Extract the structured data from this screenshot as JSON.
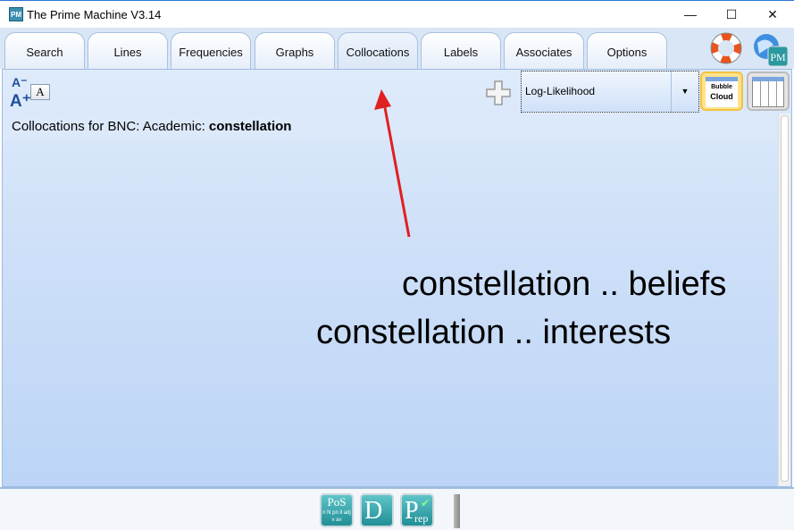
{
  "window": {
    "title": "The Prime Machine V3.14",
    "icon": "PM",
    "minimize": "—",
    "maximize": "☐",
    "close": "✕"
  },
  "tabs": [
    {
      "label": "Search"
    },
    {
      "label": "Lines"
    },
    {
      "label": "Frequencies"
    },
    {
      "label": "Graphs"
    },
    {
      "label": "Collocations",
      "active": true
    },
    {
      "label": "Labels"
    },
    {
      "label": "Associates"
    },
    {
      "label": "Options"
    }
  ],
  "toolbar": {
    "font_decrease": "A⁻",
    "font_increase": "A⁺",
    "font_box": "A",
    "measure_select": "Log-Likelihood",
    "bubble_cloud": {
      "line1": "Bubble",
      "line2": "Cloud"
    }
  },
  "heading": {
    "prefix": "Collocations for BNC: Academic: ",
    "word": "constellation"
  },
  "collocations": [
    {
      "text": "constellation .. beliefs"
    },
    {
      "text": "constellation .. interests"
    }
  ],
  "bottom": {
    "pos": {
      "main": "PoS",
      "sub": "n N pn ll adj v av"
    },
    "d": "D",
    "prep": {
      "main": "P",
      "sub": "rep"
    }
  },
  "colors": {
    "accent": "#2b78d4",
    "panel": "#cfe0f8",
    "arrow": "#e02020"
  }
}
